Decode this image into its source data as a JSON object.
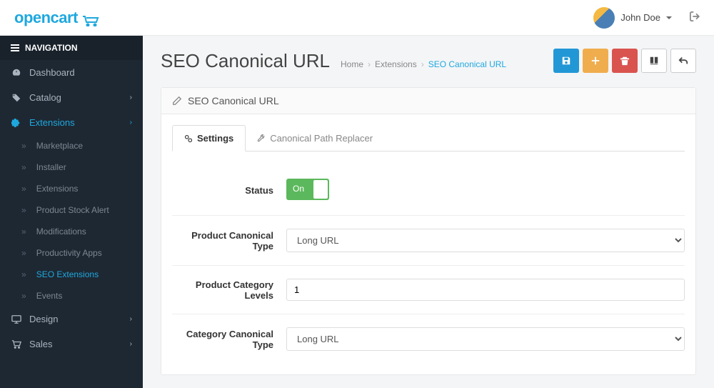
{
  "header": {
    "logo": "opencart",
    "user_name": "John Doe"
  },
  "sidebar": {
    "title": "NAVIGATION",
    "items": [
      {
        "label": "Dashboard"
      },
      {
        "label": "Catalog"
      },
      {
        "label": "Extensions"
      },
      {
        "label": "Design"
      },
      {
        "label": "Sales"
      }
    ],
    "sub_items": [
      {
        "label": "Marketplace"
      },
      {
        "label": "Installer"
      },
      {
        "label": "Extensions"
      },
      {
        "label": "Product Stock Alert"
      },
      {
        "label": "Modifications"
      },
      {
        "label": "Productivity Apps"
      },
      {
        "label": "SEO Extensions"
      },
      {
        "label": "Events"
      }
    ]
  },
  "page": {
    "title": "SEO Canonical URL",
    "breadcrumb": {
      "home": "Home",
      "extensions": "Extensions",
      "current": "SEO Canonical URL"
    }
  },
  "panel": {
    "title": "SEO Canonical URL",
    "tabs": {
      "settings": "Settings",
      "replacer": "Canonical Path Replacer"
    },
    "form": {
      "status_label": "Status",
      "status_value": "On",
      "product_canonical_label": "Product Canonical Type",
      "product_canonical_value": "Long URL",
      "product_levels_label": "Product Category Levels",
      "product_levels_value": "1",
      "category_canonical_label": "Category Canonical Type",
      "category_canonical_value": "Long URL"
    }
  }
}
